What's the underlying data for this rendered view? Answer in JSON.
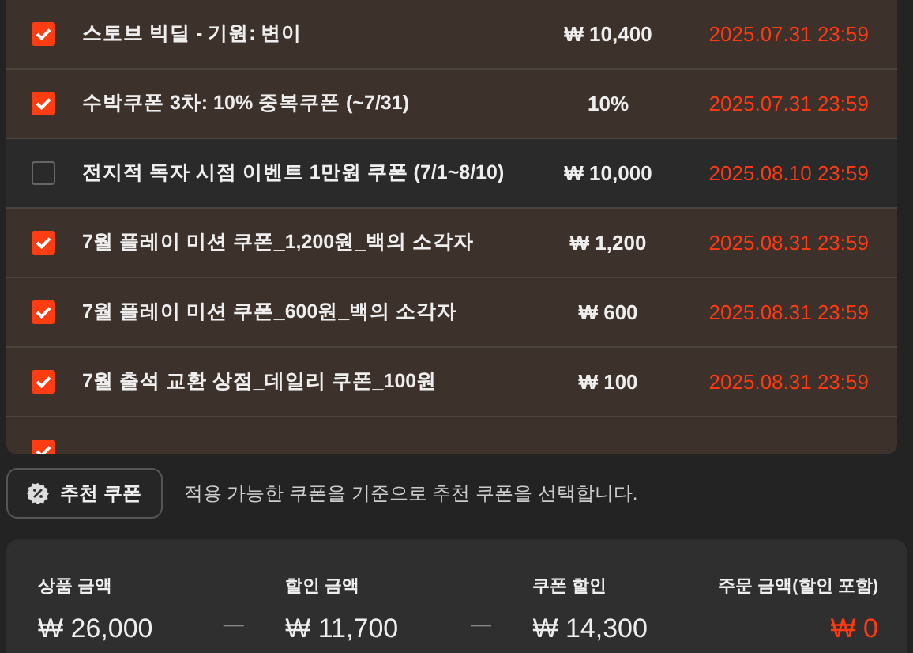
{
  "coupons": [
    {
      "name": "스토브 빅딜 - 기원: 변이",
      "discount": "₩ 10,400",
      "expires": "2025.07.31 23:59",
      "checked": true
    },
    {
      "name": "수박쿠폰 3차: 10% 중복쿠폰 (~7/31)",
      "discount": "10%",
      "expires": "2025.07.31 23:59",
      "checked": true
    },
    {
      "name": "전지적 독자 시점 이벤트 1만원 쿠폰 (7/1~8/10)",
      "discount": "₩ 10,000",
      "expires": "2025.08.10 23:59",
      "checked": false
    },
    {
      "name": "7월 플레이 미션 쿠폰_1,200원_백의 소각자",
      "discount": "₩ 1,200",
      "expires": "2025.08.31 23:59",
      "checked": true
    },
    {
      "name": "7월 플레이 미션 쿠폰_600원_백의 소각자",
      "discount": "₩ 600",
      "expires": "2025.08.31 23:59",
      "checked": true
    },
    {
      "name": "7월 출석 교환 상점_데일리 쿠폰_100원",
      "discount": "₩ 100",
      "expires": "2025.08.31 23:59",
      "checked": true
    },
    {
      "checked": true
    }
  ],
  "recommend": {
    "button": "추천 쿠폰",
    "description": "적용 가능한 쿠폰을 기준으로 추천 쿠폰을 선택합니다."
  },
  "summary": [
    {
      "label": "상품 금액",
      "value": "₩ 26,000",
      "kind": "amount"
    },
    {
      "operator": "—",
      "kind": "operator"
    },
    {
      "label": "할인 금액",
      "value": "₩ 11,700",
      "kind": "amount"
    },
    {
      "operator": "—",
      "kind": "operator"
    },
    {
      "label": "쿠폰 할인",
      "value": "₩ 14,300",
      "kind": "amount"
    },
    {
      "label": "주문 금액(할인 포함)",
      "value": "₩ 0",
      "kind": "total"
    }
  ]
}
